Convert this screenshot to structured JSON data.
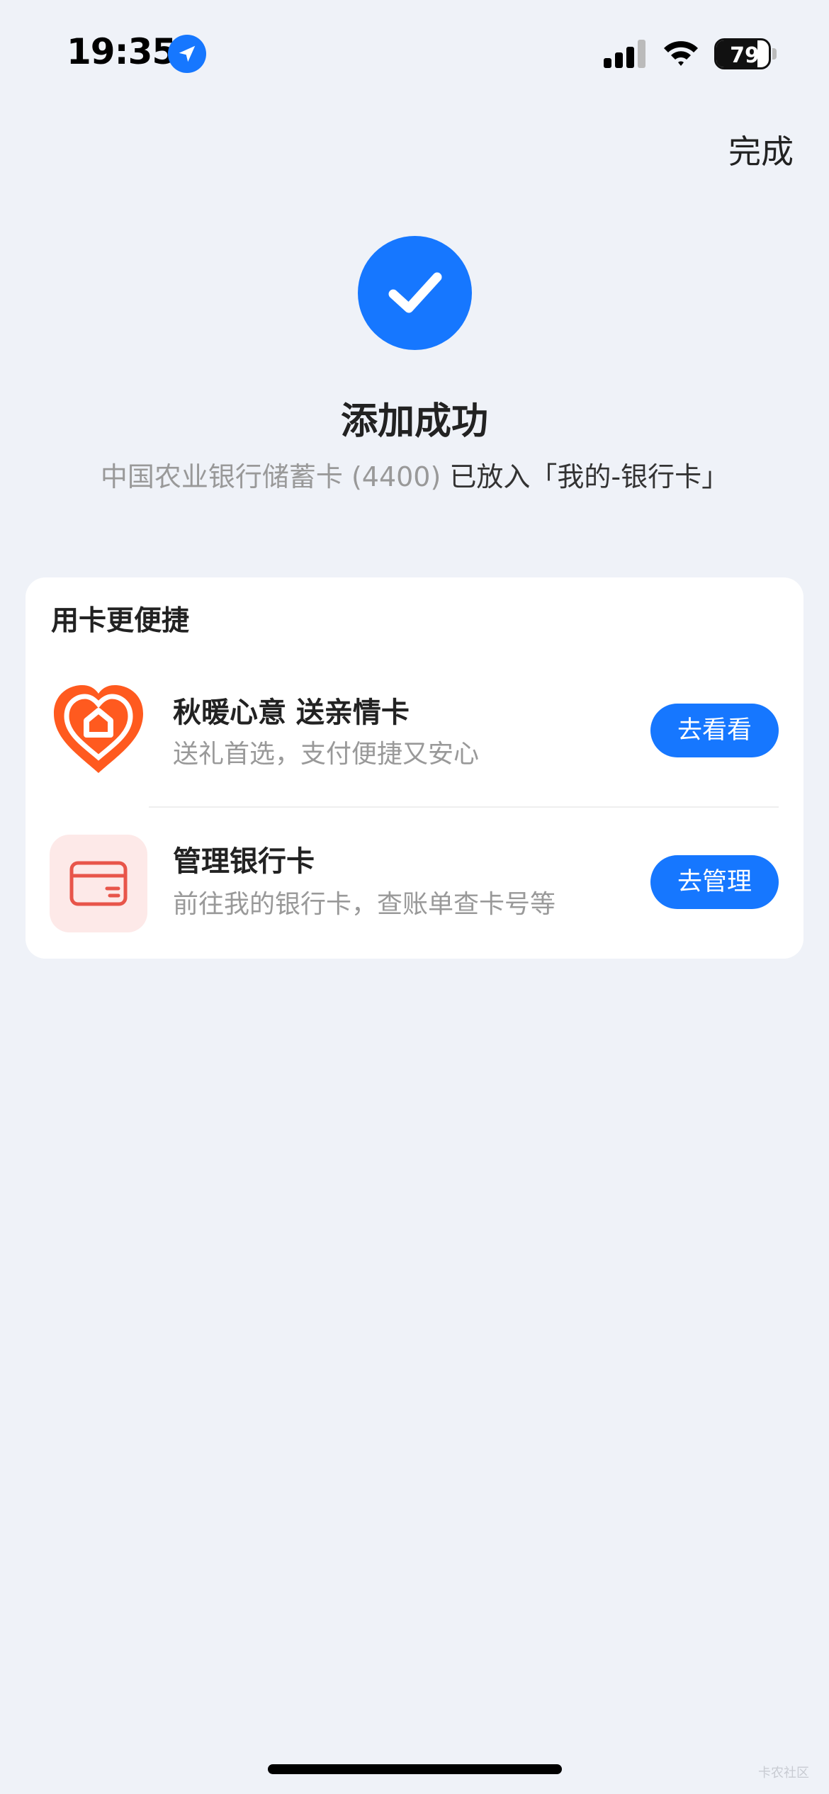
{
  "status_bar": {
    "time": "19:35",
    "battery": "79",
    "battery_level": 0.79,
    "icons": [
      "location-arrow-icon",
      "cellular-signal-icon",
      "wifi-icon",
      "battery-icon"
    ]
  },
  "header": {
    "done_label": "完成"
  },
  "result": {
    "icon": "checkmark-icon",
    "title": "添加成功",
    "desc_prefix": "中国农业银行储蓄卡 (4400) ",
    "desc_suffix": "已放入「我的-银行卡」"
  },
  "card": {
    "title": "用卡更便捷",
    "items": [
      {
        "icon": "heart-home-icon",
        "title": "秋暖心意 送亲情卡",
        "subtitle": "送礼首选，支付便捷又安心",
        "button": "去看看"
      },
      {
        "icon": "bank-card-icon",
        "title": "管理银行卡",
        "subtitle": "前往我的银行卡，查账单查卡号等",
        "button": "去管理"
      }
    ]
  },
  "colors": {
    "accent": "#1677ff",
    "background": "#eff2f8",
    "heart_orange": "#ff5a1f",
    "card_icon_bg": "#fde9e8",
    "card_icon_red": "#e8554a"
  },
  "watermark": "卡农社区"
}
